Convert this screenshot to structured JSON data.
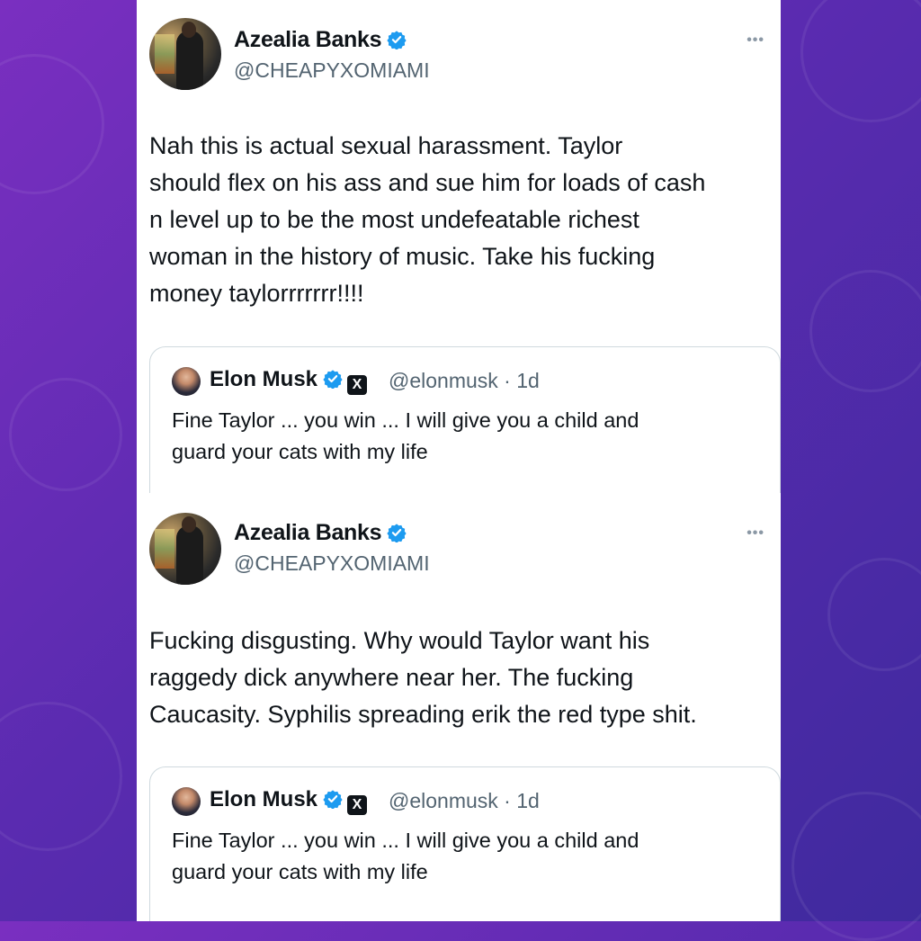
{
  "posts": [
    {
      "author": {
        "name": "Azealia Banks",
        "handle": "@CHEAPYXOMIAMI"
      },
      "more": "•••",
      "text": "Nah this is actual sexual harassment.  Taylor\nshould flex on his ass and sue him for loads of cash\nn level up to be the most undefeatable richest\nwoman in the history of music. Take his fucking\nmoney taylorrrrrrr!!!!",
      "quote": {
        "name": "Elon Musk",
        "badge": "X",
        "meta": "@elonmusk · 1d",
        "text": "Fine Taylor ... you win ... I will give you a child and\nguard your cats with my life"
      }
    },
    {
      "author": {
        "name": "Azealia Banks",
        "handle": "@CHEAPYXOMIAMI"
      },
      "more": "•••",
      "text": "Fucking disgusting. Why would Taylor want his\nraggedy dick anywhere near her. The fucking\nCaucasity. Syphilis spreading erik the red type shit.",
      "quote": {
        "name": "Elon Musk",
        "badge": "X",
        "meta": "@elonmusk · 1d",
        "text": "Fine Taylor ... you win ... I will give you a child and\nguard your cats with my life"
      }
    }
  ],
  "colors": {
    "verified": "#1d9bf0",
    "text": "#0f1419",
    "muted": "#536471",
    "background_from": "#7a2fc0",
    "background_to": "#3f2a9e"
  }
}
